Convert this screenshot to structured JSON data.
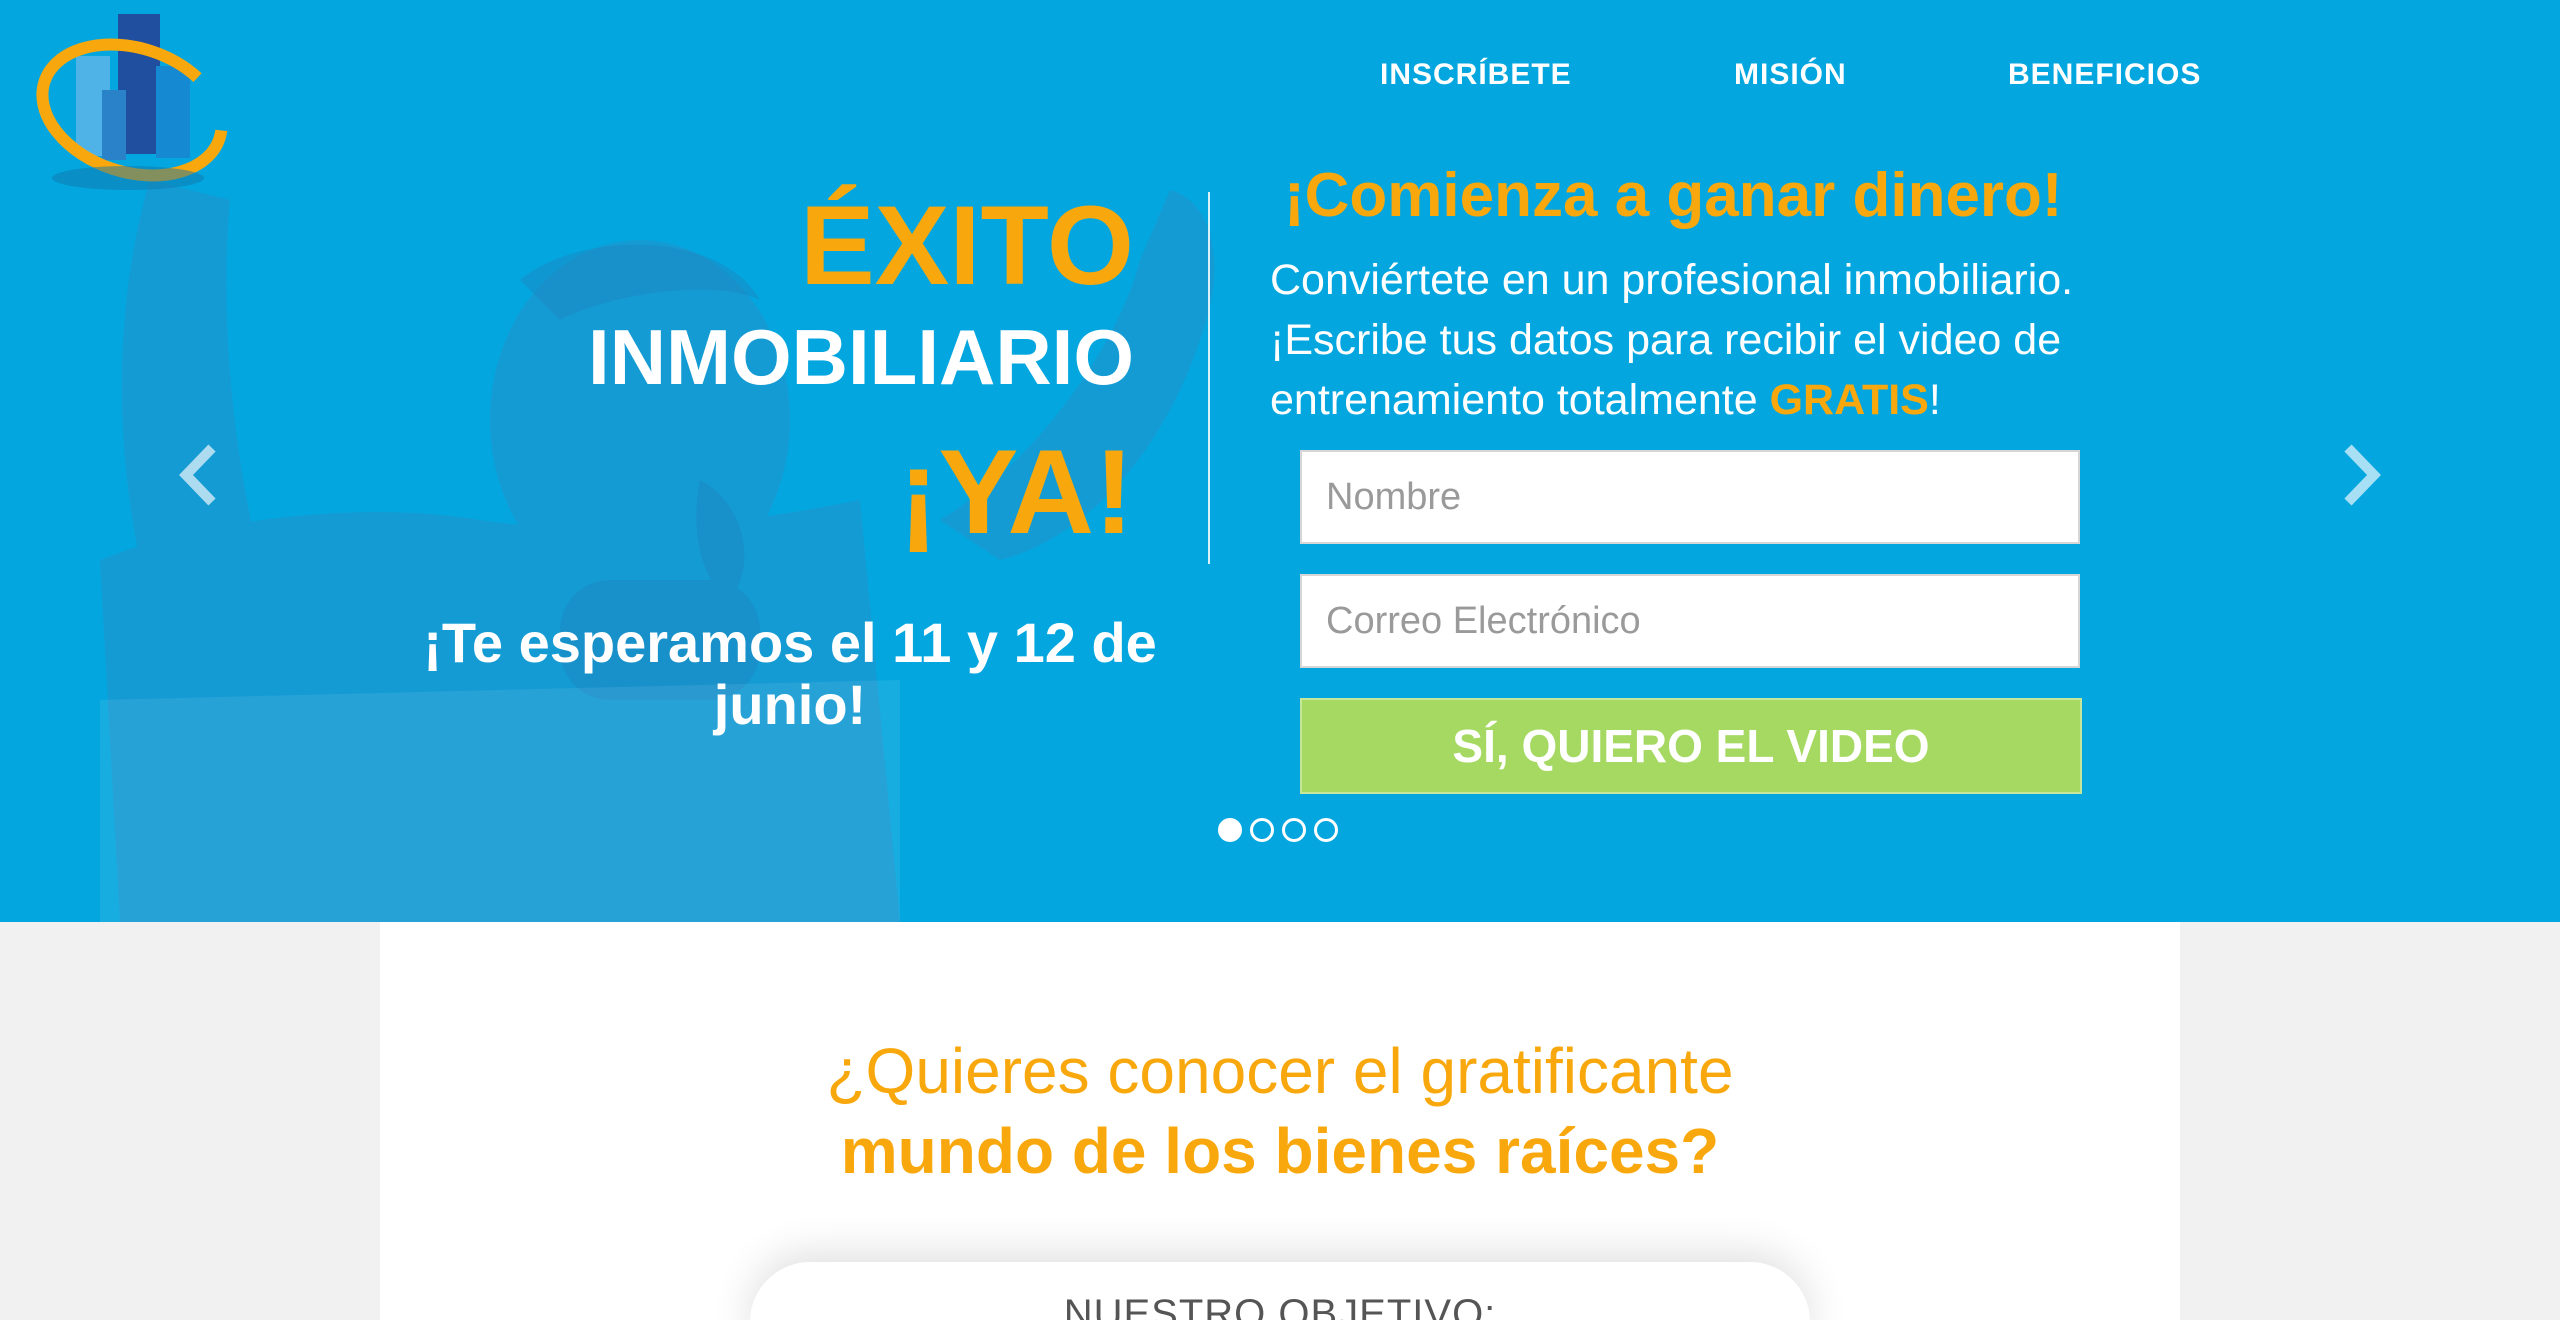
{
  "nav": {
    "items": [
      {
        "label": "INSCRÍBETE"
      },
      {
        "label": "MISIÓN"
      },
      {
        "label": "BENEFICIOS"
      }
    ]
  },
  "hero": {
    "headline_exito": "ÉXITO",
    "headline_inmobiliario": "INMOBILIARIO",
    "headline_ya": "¡YA!",
    "date_text": "¡Te esperamos el 11 y 12 de junio!",
    "offer_title": "¡Comienza a ganar dinero!",
    "offer_line1": "Conviértete en un profesional inmobiliario.",
    "offer_line2": "¡Escribe tus datos para recibir el video de entrenamiento totalmente",
    "offer_gratis": "GRATIS",
    "offer_end": "!",
    "name_placeholder": "Nombre",
    "email_placeholder": "Correo Electrónico",
    "submit_label": "SÍ, QUIERO EL VIDEO",
    "slides": 4,
    "active_slide": 1,
    "prev_icon": "chevron-left-icon",
    "next_icon": "chevron-right-icon"
  },
  "content": {
    "question_line1": "¿Quieres conocer el gratificante",
    "question_line2": "mundo de los bienes raíces?",
    "objective_title": "NUESTRO OBJETIVO:"
  },
  "colors": {
    "hero_blue": "#04a6df",
    "accent_orange": "#f8a80d",
    "button_green": "#a5d962",
    "page_bg": "#f1f1f1"
  }
}
